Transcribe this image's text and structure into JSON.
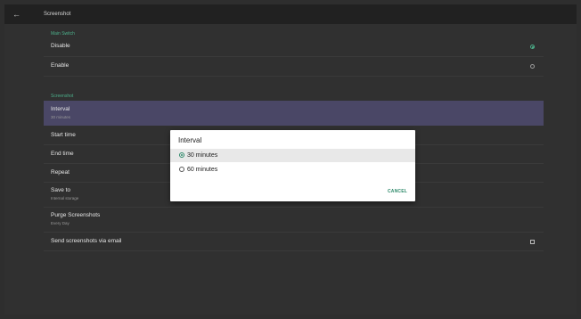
{
  "topbar": {
    "back_icon": "arrow-left-icon",
    "title": "Screenshot"
  },
  "main_switch": {
    "section_title": "Main Switch",
    "options": [
      {
        "label": "Disable",
        "selected": true
      },
      {
        "label": "Enable",
        "selected": false
      }
    ]
  },
  "screenshot_section": {
    "section_title": "Screenshot",
    "interval": {
      "label": "Interval",
      "value": "30 minutes"
    },
    "start_time": {
      "label": "Start time"
    },
    "end_time": {
      "label": "End time"
    },
    "repeat": {
      "label": "Repeat"
    },
    "save_to": {
      "label": "Save to",
      "value": "Internal storage"
    },
    "purge": {
      "label": "Purge Screenshots",
      "value": "Every Day"
    },
    "send_email": {
      "label": "Send screenshots via email",
      "checked": false
    }
  },
  "dialog": {
    "title": "Interval",
    "options": [
      {
        "label": "30 minutes",
        "selected": true
      },
      {
        "label": "60 minutes",
        "selected": false
      }
    ],
    "cancel_label": "CANCEL"
  },
  "colors": {
    "accent": "#4caf8a",
    "selected_row": "#4a4766",
    "background": "#303030",
    "topbar": "#212121"
  }
}
